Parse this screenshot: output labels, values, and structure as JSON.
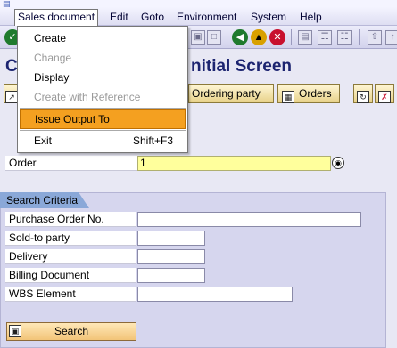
{
  "menubar": {
    "items": [
      {
        "label": "Sales document"
      },
      {
        "label": "Edit"
      },
      {
        "label": "Goto"
      },
      {
        "label": "Environment"
      },
      {
        "label": "System"
      },
      {
        "label": "Help"
      }
    ]
  },
  "dropdown": {
    "items": [
      {
        "label": "Create",
        "enabled": true
      },
      {
        "label": "Change",
        "enabled": false
      },
      {
        "label": "Display",
        "enabled": true
      },
      {
        "label": "Create with Reference",
        "enabled": false
      },
      {
        "label": "Issue Output To",
        "enabled": true,
        "highlighted": true
      },
      {
        "label": "Exit",
        "shortcut": "Shift+F3",
        "enabled": true
      }
    ]
  },
  "title": {
    "prefix": "C",
    "suffix": "nitial Screen"
  },
  "app_toolbar": {
    "ordering_party_label": "Ordering party",
    "orders_label": "Orders"
  },
  "order": {
    "label": "Order",
    "value": "1"
  },
  "search_criteria": {
    "title": "Search Criteria",
    "fields": [
      {
        "label": "Purchase Order No.",
        "value": ""
      },
      {
        "label": "Sold-to party",
        "value": ""
      },
      {
        "label": "Delivery",
        "value": ""
      },
      {
        "label": "Billing Document",
        "value": ""
      },
      {
        "label": "WBS Element",
        "value": ""
      }
    ],
    "search_button_label": "Search"
  },
  "colors": {
    "background": "#e8e8f4",
    "title": "#1c2470",
    "highlight": "#f4a020",
    "required_field": "#ffff9c",
    "group_tab": "#8aa8d8",
    "search_button": "#f2c478"
  }
}
